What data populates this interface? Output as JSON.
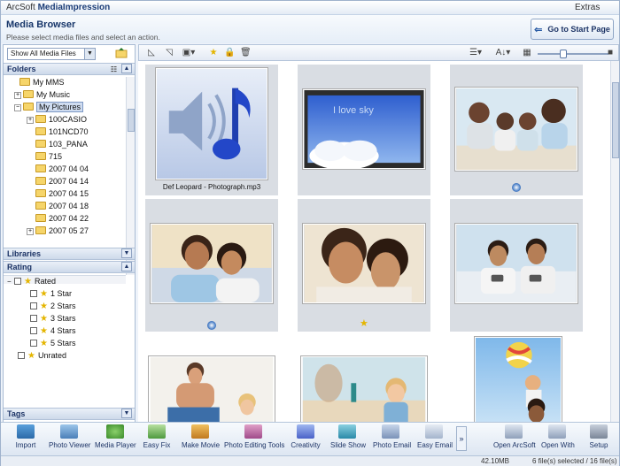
{
  "window": {
    "app_name_prefix": "ArcSoft ",
    "app_name": "MediaImpression",
    "extras": "Extras"
  },
  "header": {
    "title": "Media Browser",
    "subtitle": "Please select media files and select an action.",
    "start_button": "Go to Start Page"
  },
  "left": {
    "filter_value": "Show All Media Files",
    "sections": {
      "folders": "Folders",
      "libraries": "Libraries",
      "rating": "Rating",
      "tags": "Tags"
    },
    "tree": [
      {
        "label": "My MMS",
        "level": 1,
        "expander": ""
      },
      {
        "label": "My Music",
        "level": 1,
        "expander": "+"
      },
      {
        "label": "My Pictures",
        "level": 1,
        "expander": "−",
        "selected": true
      },
      {
        "label": "100CASIO",
        "level": 2,
        "expander": "+"
      },
      {
        "label": "101NCD70",
        "level": 2,
        "expander": ""
      },
      {
        "label": "103_PANA",
        "level": 2,
        "expander": ""
      },
      {
        "label": "715",
        "level": 2,
        "expander": ""
      },
      {
        "label": "2007 04 04",
        "level": 2,
        "expander": ""
      },
      {
        "label": "2007 04 14",
        "level": 2,
        "expander": ""
      },
      {
        "label": "2007 04 15",
        "level": 2,
        "expander": ""
      },
      {
        "label": "2007 04 18",
        "level": 2,
        "expander": ""
      },
      {
        "label": "2007 04 22",
        "level": 2,
        "expander": ""
      },
      {
        "label": "2007 05 27",
        "level": 2,
        "expander": "+"
      }
    ],
    "rating": {
      "rated": "Rated",
      "stars": [
        "1 Star",
        "2 Stars",
        "3 Stars",
        "4 Stars",
        "5 Stars"
      ],
      "unrated": "Unrated"
    }
  },
  "grid": {
    "items": [
      {
        "caption": "Def Leopard - Photograph.mp3",
        "badge": ""
      },
      {
        "caption": "",
        "badge": ""
      },
      {
        "caption": "",
        "badge": "globe"
      },
      {
        "caption": "",
        "badge": "globe"
      },
      {
        "caption": "",
        "badge": "star"
      },
      {
        "caption": "",
        "badge": ""
      },
      {
        "caption": "",
        "badge": ""
      },
      {
        "caption": "",
        "badge": ""
      },
      {
        "caption": "",
        "badge": ""
      }
    ],
    "sky_text": "I love sky"
  },
  "bottom": {
    "actions": [
      "Import",
      "Photo Viewer",
      "Media Player",
      "Easy Fix",
      "Make Movie",
      "Photo Editing Tools",
      "Creativity",
      "Slide Show",
      "Photo Email",
      "Easy Email"
    ],
    "right_actions": [
      "Open ArcSoft",
      "Open With",
      "Setup"
    ],
    "more": "»"
  },
  "status": {
    "size": "42.10MB",
    "selection": "6 file(s) selected / 16 file(s)"
  },
  "colors": {
    "accent": "#1d3466",
    "folder": "#f6d56a",
    "star": "#e4b500"
  }
}
